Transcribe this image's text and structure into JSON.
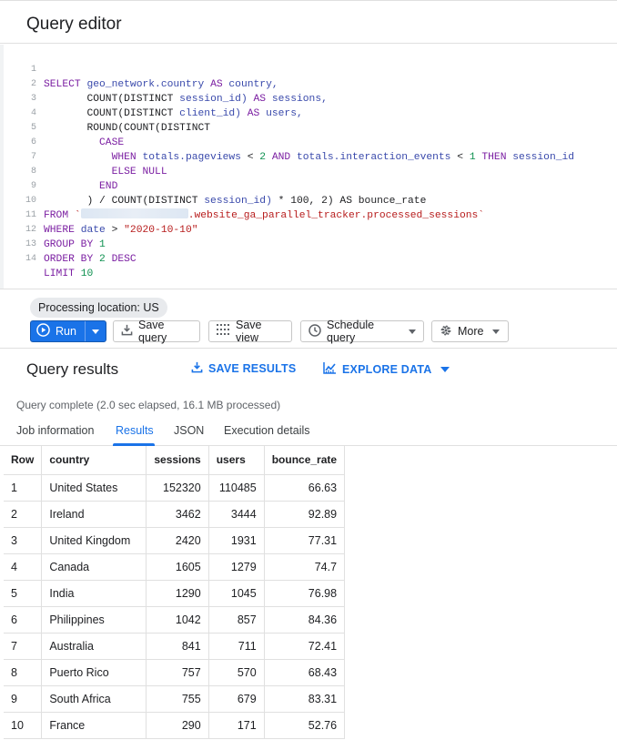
{
  "editor": {
    "title": "Query editor",
    "lines": [
      {
        "n": "1"
      },
      {
        "n": "2"
      },
      {
        "n": "3"
      },
      {
        "n": "4"
      },
      {
        "n": "5"
      },
      {
        "n": "6"
      },
      {
        "n": "7"
      },
      {
        "n": "8"
      },
      {
        "n": "9"
      },
      {
        "n": "10"
      },
      {
        "n": "11"
      },
      {
        "n": "12"
      },
      {
        "n": "13"
      },
      {
        "n": "14"
      }
    ],
    "tokens": {
      "l1": [
        "SELECT",
        "geo_network.country",
        "AS",
        "country,"
      ],
      "l2": [
        "COUNT(DISTINCT",
        "session_id)",
        "AS",
        "sessions,"
      ],
      "l3": [
        "COUNT(DISTINCT",
        "client_id)",
        "AS",
        "users,"
      ],
      "l4": [
        "ROUND(COUNT(DISTINCT"
      ],
      "l5": [
        "CASE"
      ],
      "l6": [
        "WHEN",
        "totals.pageviews",
        "<",
        "2",
        "AND",
        "totals.interaction_events",
        "<",
        "1",
        "THEN",
        "session_id"
      ],
      "l7": [
        "ELSE",
        "NULL"
      ],
      "l8": [
        "END"
      ],
      "l9": [
        ") / COUNT(DISTINCT",
        "session_id)",
        "* 100, 2) AS bounce_rate"
      ],
      "l10": [
        "FROM",
        "`",
        ".website_ga_parallel_tracker.processed_sessions`"
      ],
      "l11": [
        "WHERE",
        "date",
        ">",
        "\"2020-10-10\""
      ],
      "l12": [
        "GROUP BY",
        "1"
      ],
      "l13": [
        "ORDER BY",
        "2",
        "DESC"
      ],
      "l14": [
        "LIMIT",
        "10"
      ]
    }
  },
  "toolbar": {
    "processing_location": "Processing location: US",
    "run_label": "Run",
    "save_query_label": "Save query",
    "save_view_label": "Save view",
    "schedule_query_label": "Schedule query",
    "more_label": "More"
  },
  "results": {
    "title": "Query results",
    "save_results_label": "SAVE RESULTS",
    "explore_data_label": "EXPLORE DATA",
    "status": "Query complete (2.0 sec elapsed, 16.1 MB processed)",
    "tabs": [
      "Job information",
      "Results",
      "JSON",
      "Execution details"
    ],
    "columns": [
      "Row",
      "country",
      "sessions",
      "users",
      "bounce_rate"
    ],
    "rows": [
      [
        "1",
        "United States",
        "152320",
        "110485",
        "66.63"
      ],
      [
        "2",
        "Ireland",
        "3462",
        "3444",
        "92.89"
      ],
      [
        "3",
        "United Kingdom",
        "2420",
        "1931",
        "77.31"
      ],
      [
        "4",
        "Canada",
        "1605",
        "1279",
        "74.7"
      ],
      [
        "5",
        "India",
        "1290",
        "1045",
        "76.98"
      ],
      [
        "6",
        "Philippines",
        "1042",
        "857",
        "84.36"
      ],
      [
        "7",
        "Australia",
        "841",
        "711",
        "72.41"
      ],
      [
        "8",
        "Puerto Rico",
        "757",
        "570",
        "68.43"
      ],
      [
        "9",
        "South Africa",
        "755",
        "679",
        "83.31"
      ],
      [
        "10",
        "France",
        "290",
        "171",
        "52.76"
      ]
    ]
  },
  "colors": {
    "accent": "#1a73e8",
    "keyword": "#7b1fa2",
    "identifier": "#3949ab",
    "string": "#b71c1c",
    "number": "#0d904f"
  },
  "icons": [
    "play-circle-icon",
    "dropdown-caret-icon",
    "save-download-icon",
    "grid-view-icon",
    "clock-icon",
    "gear-icon",
    "download-icon",
    "chart-icon"
  ]
}
